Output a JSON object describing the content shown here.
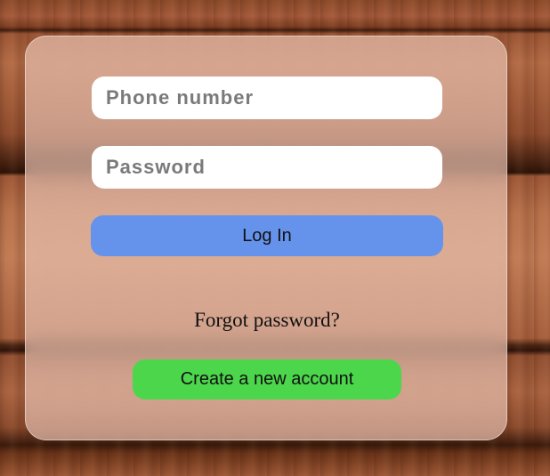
{
  "login_form": {
    "phone_placeholder": "Phone number",
    "phone_value": "",
    "password_placeholder": "Password",
    "password_value": "",
    "login_label": "Log In",
    "forgot_label": "Forgot password?",
    "create_account_label": "Create a new account"
  },
  "colors": {
    "login_button": "#6593ec",
    "create_button": "#4cd64c",
    "card": "rgba(240,205,190,0.62)"
  }
}
